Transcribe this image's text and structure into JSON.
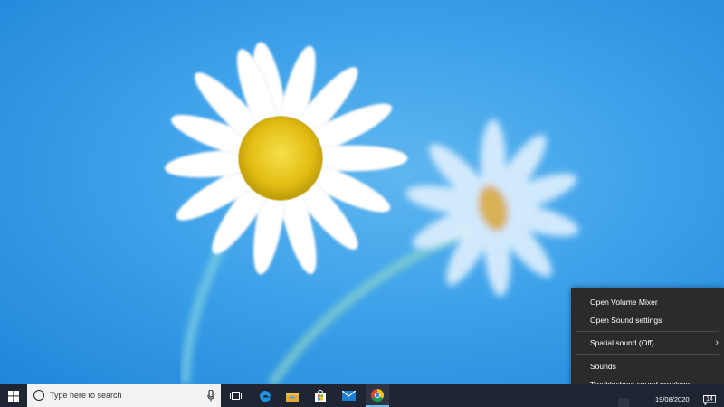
{
  "desktop": {
    "wallpaper": "daisy-flowers-blue-sky"
  },
  "sound_menu": {
    "items": [
      {
        "label": "Open Volume Mixer"
      },
      {
        "label": "Open Sound settings"
      },
      {
        "label": "Spatial sound (Off)",
        "submenu": true
      },
      {
        "label": "Sounds"
      },
      {
        "label": "Troubleshoot sound problems"
      }
    ],
    "background": "#2b2b2b",
    "text_color": "#ffffff"
  },
  "taskbar": {
    "background": "#1f2533",
    "search_placeholder": "Type here to search",
    "pinned": [
      {
        "name": "task-view-icon"
      },
      {
        "name": "edge-icon"
      },
      {
        "name": "file-explorer-icon"
      },
      {
        "name": "store-icon"
      },
      {
        "name": "mail-icon"
      },
      {
        "name": "chrome-icon"
      }
    ],
    "date": "19/08/2020",
    "notification_count": "14"
  }
}
